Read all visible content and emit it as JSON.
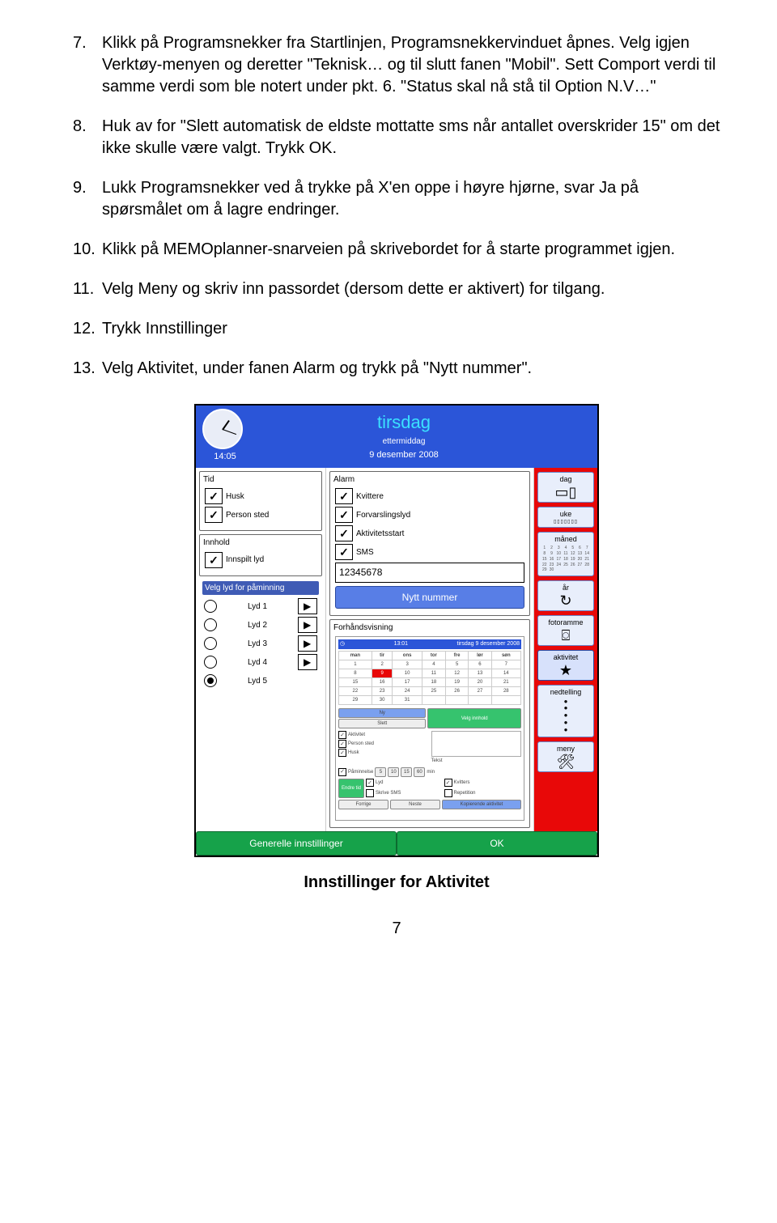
{
  "list": {
    "i7": {
      "num": "7.",
      "text": "Klikk på Programsnekker fra Startlinjen, Programsnekkervinduet åpnes. Velg igjen Verktøy-menyen og deretter \"Teknisk… og til slutt fanen \"Mobil\". Sett Comport verdi til samme verdi som ble notert under pkt. 6. \"Status skal nå stå til Option N.V…\""
    },
    "i8": {
      "num": "8.",
      "text": "Huk av for \"Slett automatisk de eldste mottatte sms når antallet overskrider 15\" om det ikke skulle være valgt. Trykk OK."
    },
    "i9": {
      "num": "9.",
      "text": "Lukk Programsnekker ved å trykke på X'en oppe i høyre hjørne, svar Ja på spørsmålet om å lagre endringer."
    },
    "i10": {
      "num": "10.",
      "text": "Klikk på  MEMOplanner-snarveien på skrivebordet for å starte programmet igjen."
    },
    "i11": {
      "num": "11.",
      "text": "Velg Meny og skriv inn passordet (dersom dette er aktivert) for tilgang."
    },
    "i12": {
      "num": "12.",
      "text": "Trykk Innstillinger"
    },
    "i13": {
      "num": "13.",
      "text": "Velg Aktivitet, under fanen Alarm og trykk på \"Nytt nummer\"."
    }
  },
  "ss": {
    "header": {
      "time": "14:05",
      "day": "tirsdag",
      "sub": "ettermiddag",
      "date": "9 desember 2008"
    },
    "left": {
      "tid": {
        "title": "Tid",
        "c1": "Husk",
        "c2": "Person sted"
      },
      "innhold": {
        "title": "Innhold",
        "c1": "Innspilt lyd"
      },
      "lyd": {
        "title": "Velg lyd for påminning",
        "r1": "Lyd 1",
        "r2": "Lyd 2",
        "r3": "Lyd 3",
        "r4": "Lyd 4",
        "r5": "Lyd 5"
      }
    },
    "mid": {
      "alarm": {
        "title": "Alarm",
        "c1": "Kvittere",
        "c2": "Forvarslingslyd",
        "c3": "Aktivitetsstart",
        "c4": "SMS",
        "input": "12345678",
        "btn": "Nytt nummer"
      },
      "preview": {
        "title": "Forhåndsvisning",
        "head_time": "13:01",
        "head_date": "tirsdag 9 desember 2008",
        "btn_ny": "Ny",
        "btn_slett": "Slett",
        "btn_velg": "Velg innhold",
        "chk_akt": "Aktivitet",
        "chk_pers": "Person sted",
        "chk_husk": "Husk",
        "chk_tekst": "Tekst",
        "rem_lbl": "Påminnelse",
        "rem_v": [
          "5",
          "10",
          "15",
          "60",
          "min"
        ],
        "endre": "Endre tid",
        "b_lyd": "Lyd",
        "b_kv": "Kvitters",
        "b_sms": "Skrive SMS",
        "b_rep": "Repetition",
        "b_for": "Forrige",
        "b_neste": "Neste",
        "b_kop": "Kopierende aktivitet"
      }
    },
    "right": {
      "dag": "dag",
      "uke": "uke",
      "maned": "måned",
      "ar": "år",
      "foto": "fotoramme",
      "akt": "aktivitet",
      "ned": "nedtelling",
      "meny": "meny"
    },
    "footer": {
      "left": "Generelle innstillinger",
      "right": "OK"
    }
  },
  "caption": "Innstillinger for Aktivitet",
  "page": "7"
}
